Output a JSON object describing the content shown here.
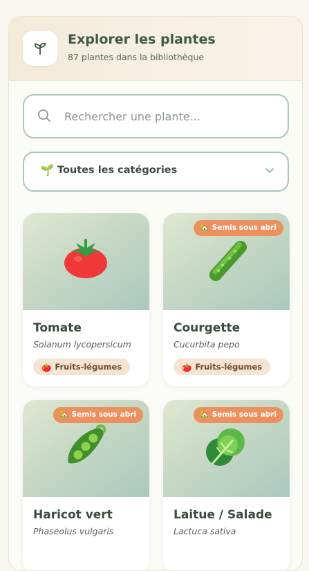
{
  "header": {
    "title": "Explorer les plantes",
    "subtitle": "87 plantes dans la bibliothèque",
    "logo_icon": "seedling-icon"
  },
  "search": {
    "placeholder": "Rechercher une plante...",
    "value": ""
  },
  "category_select": {
    "icon": "🌱",
    "selected": "Toutes les catégories"
  },
  "colors": {
    "accent": "#3d5a42",
    "badge": "#ec9060",
    "tag_bg": "#f5e4d2",
    "input_border": "#a9c6bb"
  },
  "plants": [
    {
      "name": "Tomate",
      "scientific": "Solanum lycopersicum",
      "category": "Fruits-légumes",
      "category_icon": "🍅",
      "badge": "",
      "image_icon": "tomato-icon"
    },
    {
      "name": "Courgette",
      "scientific": "Cucurbita pepo",
      "category": "Fruits-légumes",
      "category_icon": "🍅",
      "badge": "Semis sous abri",
      "badge_icon": "🏡",
      "image_icon": "cucumber-icon"
    },
    {
      "name": "Haricot vert",
      "scientific": "Phaseolus vulgaris",
      "category": "",
      "category_icon": "",
      "badge": "Semis sous abri",
      "badge_icon": "🏡",
      "image_icon": "pea-pod-icon"
    },
    {
      "name": "Laitue / Salade",
      "scientific": "Lactuca sativa",
      "category": "",
      "category_icon": "",
      "badge": "Semis sous abri",
      "badge_icon": "🏡",
      "image_icon": "lettuce-icon"
    }
  ]
}
